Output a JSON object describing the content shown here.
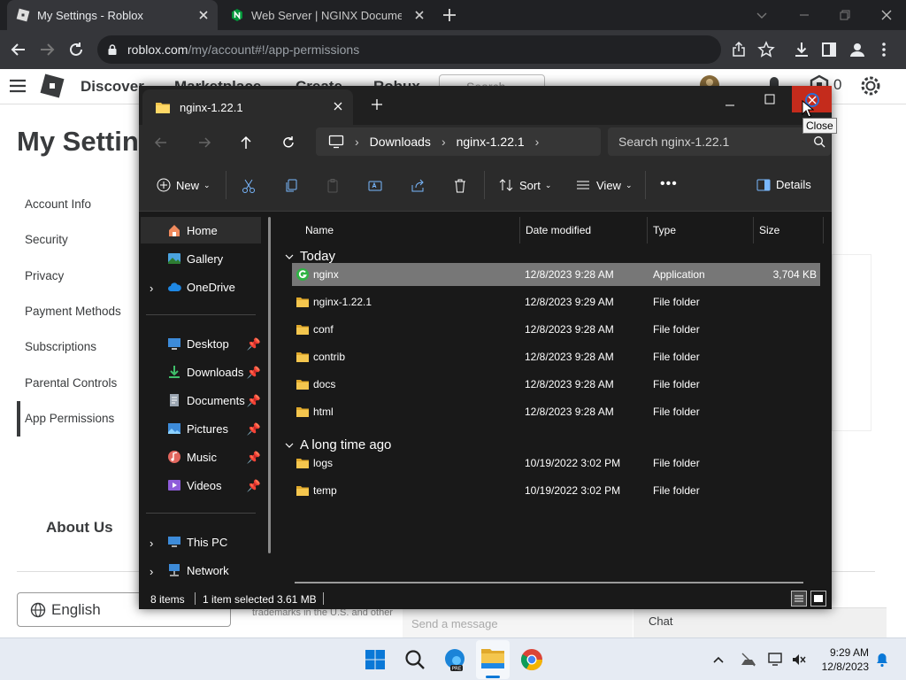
{
  "browser": {
    "tabs": [
      {
        "title": "My Settings - Roblox",
        "active": true
      },
      {
        "title": "Web Server | NGINX Documentati",
        "active": false
      }
    ],
    "url_host": "roblox.com",
    "url_path": "/my/account#!/app-permissions"
  },
  "roblox": {
    "nav": [
      "Discover",
      "Marketplace",
      "Create",
      "Robux"
    ],
    "search_placeholder": "Search",
    "robux_count": "0",
    "page_title": "My Settings",
    "sidebar": [
      "Account Info",
      "Security",
      "Privacy",
      "Payment Methods",
      "Subscriptions",
      "Parental Controls",
      "App Permissions"
    ],
    "active_sidebar": "App Permissions",
    "about": "About Us",
    "language": "English",
    "trademark": "trademarks in the U.S. and other",
    "chat_placeholder": "Send a message",
    "chat_label": "Chat"
  },
  "explorer": {
    "tab_title": "nginx-1.22.1",
    "tooltip": "Close",
    "breadcrumb": [
      "Downloads",
      "nginx-1.22.1"
    ],
    "search_placeholder": "Search nginx-1.22.1",
    "commands": {
      "new": "New",
      "sort": "Sort",
      "view": "View",
      "details": "Details"
    },
    "nav_pane": {
      "top": [
        "Home",
        "Gallery",
        "OneDrive"
      ],
      "quick": [
        "Desktop",
        "Downloads",
        "Documents",
        "Pictures",
        "Music",
        "Videos"
      ],
      "bottom": [
        "This PC",
        "Network"
      ]
    },
    "columns": [
      "Name",
      "Date modified",
      "Type",
      "Size"
    ],
    "groups": [
      {
        "label": "Today",
        "rows": [
          {
            "name": "nginx",
            "date": "12/8/2023 9:28 AM",
            "type": "Application",
            "size": "3,704 KB",
            "selected": true
          },
          {
            "name": "nginx-1.22.1",
            "date": "12/8/2023 9:29 AM",
            "type": "File folder",
            "size": ""
          },
          {
            "name": "conf",
            "date": "12/8/2023 9:28 AM",
            "type": "File folder",
            "size": ""
          },
          {
            "name": "contrib",
            "date": "12/8/2023 9:28 AM",
            "type": "File folder",
            "size": ""
          },
          {
            "name": "docs",
            "date": "12/8/2023 9:28 AM",
            "type": "File folder",
            "size": ""
          },
          {
            "name": "html",
            "date": "12/8/2023 9:28 AM",
            "type": "File folder",
            "size": ""
          }
        ]
      },
      {
        "label": "A long time ago",
        "rows": [
          {
            "name": "logs",
            "date": "10/19/2022 3:02 PM",
            "type": "File folder",
            "size": ""
          },
          {
            "name": "temp",
            "date": "10/19/2022 3:02 PM",
            "type": "File folder",
            "size": ""
          }
        ]
      }
    ],
    "status": {
      "items": "8 items",
      "selected": "1 item selected",
      "size": "3.61 MB"
    }
  },
  "taskbar": {
    "time": "9:29 AM",
    "date": "12/8/2023"
  },
  "colors": {
    "accent": "#0078d4",
    "close_red": "#c42b1c",
    "folder": "#f4c64e"
  }
}
